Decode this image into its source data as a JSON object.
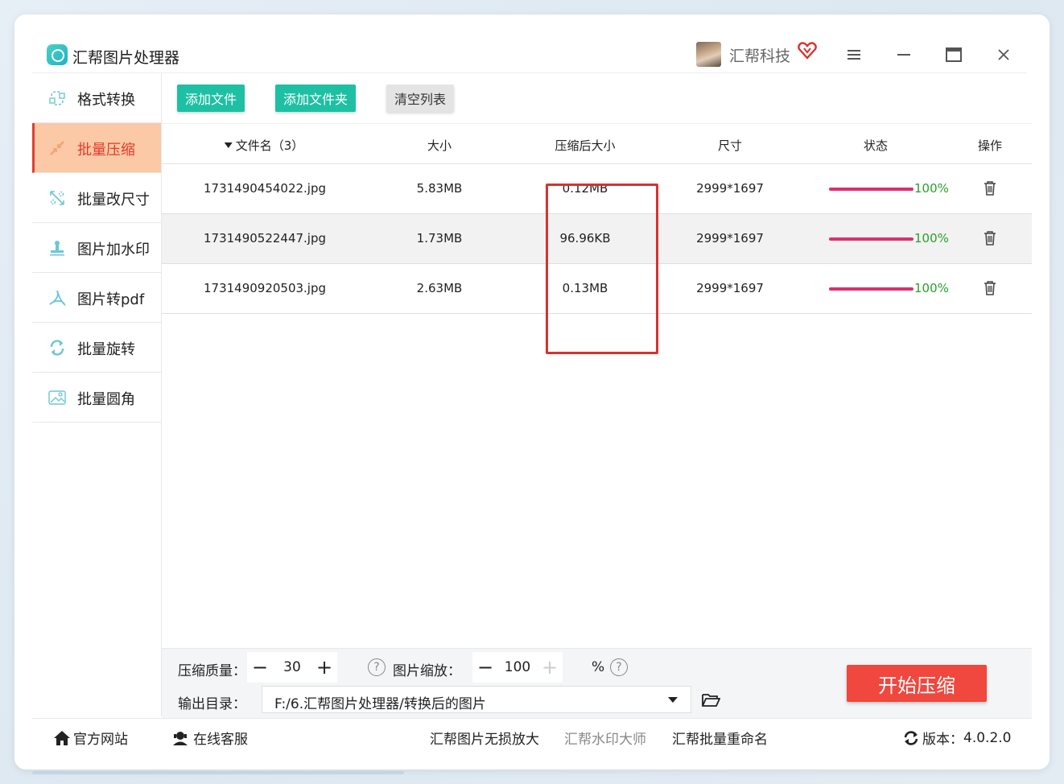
{
  "app": {
    "title": "汇帮图片处理器",
    "user_name": "汇帮科技"
  },
  "sidebar": {
    "items": [
      {
        "label": "格式转换",
        "icon": "format-convert-icon",
        "active": false
      },
      {
        "label": "批量压缩",
        "icon": "compress-icon",
        "active": true
      },
      {
        "label": "批量改尺寸",
        "icon": "resize-icon",
        "active": false
      },
      {
        "label": "图片加水印",
        "icon": "watermark-icon",
        "active": false
      },
      {
        "label": "图片转pdf",
        "icon": "pdf-icon",
        "active": false
      },
      {
        "label": "批量旋转",
        "icon": "rotate-icon",
        "active": false
      },
      {
        "label": "批量圆角",
        "icon": "round-corner-icon",
        "active": false
      }
    ]
  },
  "toolbar": {
    "add_file": "添加文件",
    "add_folder": "添加文件夹",
    "clear_list": "清空列表"
  },
  "table": {
    "headers": {
      "filename": "文件名（3）",
      "size": "大小",
      "compressed": "压缩后大小",
      "dimensions": "尺寸",
      "status": "状态",
      "action": "操作"
    },
    "rows": [
      {
        "filename": "1731490454022.jpg",
        "size": "5.83MB",
        "compressed": "0.12MB",
        "dimensions": "2999*1697",
        "progress": 100,
        "status": "100%"
      },
      {
        "filename": "1731490522447.jpg",
        "size": "1.73MB",
        "compressed": "96.96KB",
        "dimensions": "2999*1697",
        "progress": 100,
        "status": "100%"
      },
      {
        "filename": "1731490920503.jpg",
        "size": "2.63MB",
        "compressed": "0.13MB",
        "dimensions": "2999*1697",
        "progress": 100,
        "status": "100%"
      }
    ]
  },
  "settings": {
    "quality_label": "压缩质量：",
    "quality_value": "30",
    "scale_label": "图片缩放：",
    "scale_value": "100",
    "scale_unit": "%",
    "help": "?",
    "minus": "−",
    "plus": "+",
    "output_label": "输出目录：",
    "output_path": "F:/6.汇帮图片处理器/转换后的图片",
    "start_button": "开始压缩"
  },
  "footer": {
    "official_site": "官方网站",
    "online_service": "在线客服",
    "link1": "汇帮图片无损放大",
    "link2": "汇帮水印大师",
    "link3": "汇帮批量重命名",
    "version_label": "版本：",
    "version": "4.0.2.0"
  },
  "colors": {
    "accent_teal": "#1ec0a3",
    "active_bg": "#fbc9a6",
    "active_text": "#e23a2a",
    "progress": "#dd2f6d",
    "percent": "#2aa02a",
    "start_button": "#f0473e",
    "highlight": "#d9312e"
  }
}
